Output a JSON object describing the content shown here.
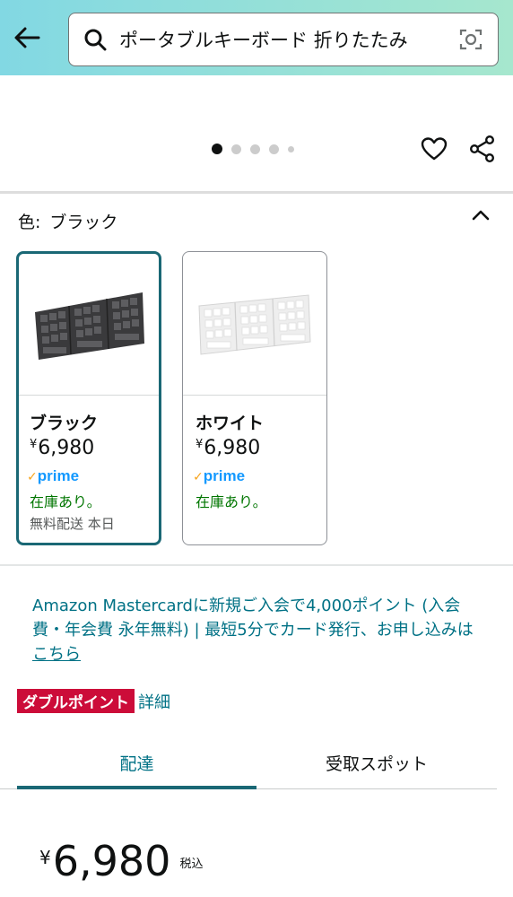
{
  "search": {
    "query": "ポータブルキーボード 折りたたみ"
  },
  "image_carousel": {
    "dot_count": 5,
    "active_index": 0
  },
  "color_selector": {
    "label": "色:",
    "selected_value": "ブラック"
  },
  "variants": [
    {
      "name": "ブラック",
      "currency": "¥",
      "price": "6,980",
      "prime": "prime",
      "stock": "在庫あり。",
      "shipping": "無料配送 本日"
    },
    {
      "name": "ホワイト",
      "currency": "¥",
      "price": "6,980",
      "prime": "prime",
      "stock": "在庫あり。"
    }
  ],
  "promo": {
    "text_a": "Amazon Mastercardに新規ご入会で",
    "points": "4,000ポイント",
    "text_b": " (入会費・年会費 永年無料) | 最短5分でカード発行、お申し込みは",
    "link": "こちら"
  },
  "double_point": {
    "badge": "ダブルポイント",
    "detail_link": "詳細"
  },
  "tabs": {
    "delivery": "配達",
    "pickup": "受取スポット"
  },
  "price": {
    "currency": "¥",
    "value": "6,980",
    "tax_label": "税込"
  },
  "colors": {
    "accent_teal": "#1a6875",
    "link": "#007185",
    "stock_green": "#007600",
    "badge_red": "#cc0c39",
    "prime_blue": "#1399ff"
  }
}
